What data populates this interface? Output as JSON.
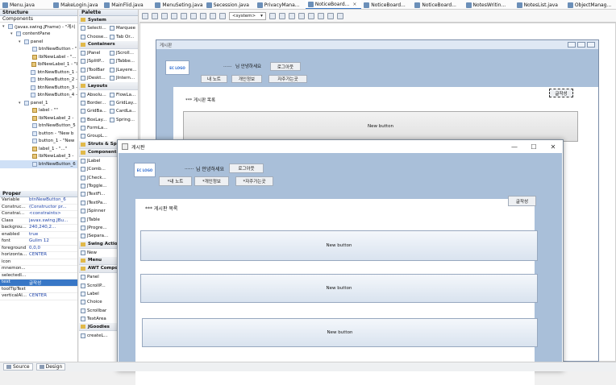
{
  "editor_tabs": [
    {
      "label": "Menu.java",
      "active": false
    },
    {
      "label": "MakeLogin.java",
      "active": false
    },
    {
      "label": "MainFlid.java",
      "active": false
    },
    {
      "label": "MenuSeting.java",
      "active": false
    },
    {
      "label": "Secession.java",
      "active": false
    },
    {
      "label": "PrivacyMana...",
      "active": false
    },
    {
      "label": "NoticeBoard...",
      "active": true
    },
    {
      "label": "NoticeBoard...",
      "active": false
    },
    {
      "label": "NoticeBoard...",
      "active": false
    },
    {
      "label": "NotesWritin...",
      "active": false
    },
    {
      "label": "NotesList.java",
      "active": false
    },
    {
      "label": "ObjectManag...",
      "active": false
    }
  ],
  "structure": {
    "title": "Structure",
    "components_label": "Components",
    "items": [
      {
        "depth": 0,
        "label": "(javax.swing.JFrame) - \"게시"
      },
      {
        "depth": 1,
        "label": "contentPane"
      },
      {
        "depth": 2,
        "label": "panel"
      },
      {
        "depth": 3,
        "label": "btnNewButton - \""
      },
      {
        "depth": 3,
        "label": "lblNewLabel - \"..."
      },
      {
        "depth": 3,
        "label": "lblNewLabel_1 - \"I"
      },
      {
        "depth": 3,
        "label": "btnNewButton_1 -"
      },
      {
        "depth": 3,
        "label": "btnNewButton_2 -"
      },
      {
        "depth": 3,
        "label": "btnNewButton_3 -"
      },
      {
        "depth": 3,
        "label": "btnNewButton_4 -"
      },
      {
        "depth": 2,
        "label": "panel_1"
      },
      {
        "depth": 3,
        "label": "label - \"\""
      },
      {
        "depth": 3,
        "label": "lblNewLabel_2 -"
      },
      {
        "depth": 3,
        "label": "btnNewButton_5"
      },
      {
        "depth": 3,
        "label": "button - \"New b"
      },
      {
        "depth": 3,
        "label": "button_1 - \"New"
      },
      {
        "depth": 3,
        "label": "label_1 - \"...\""
      },
      {
        "depth": 3,
        "label": "lblNewLabel_3 -"
      },
      {
        "depth": 3,
        "label": "btnNewButton_6"
      }
    ]
  },
  "properties": {
    "title": "Proper",
    "rows": [
      {
        "k": "Variable",
        "v": "btnNewButton_6"
      },
      {
        "k": "Construc...",
        "v": "(Constructor pr..."
      },
      {
        "k": "Constrai...",
        "v": "<constraints>"
      },
      {
        "k": "Class",
        "v": "javax.swing.JBu..."
      },
      {
        "k": "backgrou...",
        "v": "240,240,2..."
      },
      {
        "k": "enabled",
        "v": "true"
      },
      {
        "k": "font",
        "v": "Gulim 12"
      },
      {
        "k": "foreground",
        "v": "0,0,0"
      },
      {
        "k": "horizonta...",
        "v": "CENTER"
      },
      {
        "k": "icon",
        "v": ""
      },
      {
        "k": "mnemon...",
        "v": ""
      },
      {
        "k": "selectedI...",
        "v": ""
      },
      {
        "k": "text",
        "v": "글작성"
      },
      {
        "k": "toolTipText",
        "v": ""
      },
      {
        "k": "verticalAl...",
        "v": "CENTER"
      }
    ]
  },
  "palette": {
    "title": "Palette",
    "sections": [
      {
        "name": "System",
        "items": [
          "Selecti...",
          "Marquee",
          "Choose...",
          "Tab Or..."
        ]
      },
      {
        "name": "Containers",
        "items": [
          "JPanel",
          "JScroll...",
          "JSplitP...",
          "JTabbe...",
          "JToolBar",
          "JLayere...",
          "JDeskt...",
          "JIntern..."
        ]
      },
      {
        "name": "Layouts",
        "items": [
          "Absolu...",
          "FlowLa...",
          "Border...",
          "GridLay...",
          "GridBa...",
          "CardLa...",
          "BoxLay...",
          "Spring...",
          "FormLa...",
          "",
          "GroupL...",
          ""
        ]
      },
      {
        "name": "Struts & Sp",
        "items": []
      },
      {
        "name": "Component",
        "items": [
          "JLabel",
          "",
          "JComb...",
          "",
          "JCheck...",
          "",
          "JToggle...",
          "",
          "JTextFi...",
          "",
          "JTextPa...",
          "",
          "JSpinner",
          "",
          "JTable",
          "",
          "JProgre...",
          "",
          "JSepara...",
          ""
        ]
      },
      {
        "name": "Swing Actio",
        "items": [
          "New",
          ""
        ]
      },
      {
        "name": "Menu",
        "items": []
      },
      {
        "name": "AWT Compo",
        "items": [
          "Panel",
          "",
          "ScrollP...",
          "",
          "Label",
          "",
          "Choice",
          "",
          "Scrollbar",
          "",
          "TextArea",
          ""
        ]
      },
      {
        "name": "JGoodies",
        "items": [
          "createL...",
          ""
        ]
      }
    ]
  },
  "toolbar": {
    "system_select": "<system>"
  },
  "design_frame": {
    "title": "게시판",
    "logo": "EC LOGO",
    "welcome_dots": "......",
    "welcome": "님 안녕하세요",
    "logout": "로그아웃",
    "nav": [
      "내 노트",
      "개인정보",
      "자주가는곳"
    ],
    "write": "글작성",
    "board_title": "*** 게시판 목록",
    "post_button": "New button"
  },
  "floating_window": {
    "title": "게시판",
    "logo": "EC LOGO",
    "welcome_dots": "......",
    "welcome": "님 안녕하세요",
    "logout": "로그아웃",
    "nav": [
      "*내 노트",
      "*개인정보",
      "*자주가는곳"
    ],
    "write": "글작성",
    "board_title": "*** 게시판 목록",
    "posts": [
      "New button",
      "New button",
      "New button"
    ],
    "controls": {
      "min": "—",
      "max": "☐",
      "close": "✕"
    }
  },
  "status": {
    "source_tab": "Source",
    "design_tab": "Design"
  }
}
